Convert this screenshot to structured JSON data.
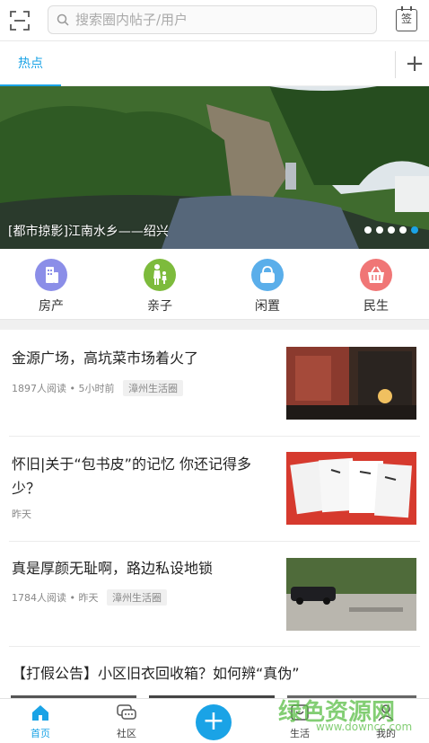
{
  "search": {
    "placeholder": "搜索圈内帖子/用户"
  },
  "header": {
    "sign_label": "签"
  },
  "tabs": {
    "hot": "热点",
    "add": "+"
  },
  "banner": {
    "caption": "[都市掠影]江南水乡——绍兴",
    "slide_count": 5,
    "active_slide": 5
  },
  "categories": [
    {
      "label": "房产",
      "icon": "building-icon",
      "color": "#8b8ee8"
    },
    {
      "label": "亲子",
      "icon": "parent-child-icon",
      "color": "#7dbb3c"
    },
    {
      "label": "闲置",
      "icon": "bag-icon",
      "color": "#5aaeea"
    },
    {
      "label": "民生",
      "icon": "basket-icon",
      "color": "#f07676"
    }
  ],
  "feed": [
    {
      "title": "金源广场，高坑菜市场着火了",
      "reads": "1897人阅读",
      "sep": "•",
      "time": "5小时前",
      "tag": "漳州生活圈"
    },
    {
      "title": "怀旧|关于“包书皮”的记忆 你还记得多少？",
      "time": "昨天"
    },
    {
      "title": "真是厚颜无耻啊，路边私设地锁",
      "reads": "1784人阅读",
      "sep": "•",
      "time": "昨天",
      "tag": "漳州生活圈"
    },
    {
      "title": "【打假公告】小区旧衣回收箱？如何辨“真伪”"
    }
  ],
  "bottom_nav": {
    "home": "首页",
    "community": "社区",
    "post": "+",
    "life": "生活",
    "mine": "我的"
  },
  "watermark": {
    "text": "绿色资源网",
    "url": "www.downcc.com"
  },
  "colors": {
    "accent": "#1aa3e6"
  }
}
